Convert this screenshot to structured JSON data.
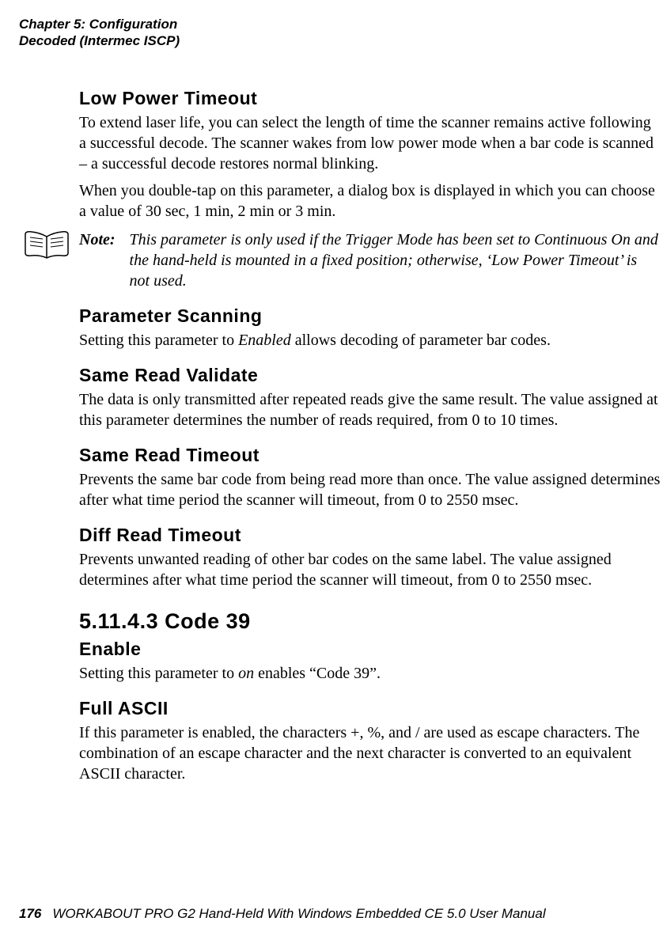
{
  "header": {
    "chapter": "Chapter 5: Configuration",
    "section": "Decoded (Intermec ISCP)"
  },
  "low_power": {
    "title": "Low Power Timeout",
    "p1": "To extend laser life, you can select the length of time the scanner remains active following a successful decode. The scanner wakes from low power mode when a bar code is scanned – a successful decode restores normal blinking.",
    "p2": "When you double-tap on this parameter, a dialog box is displayed in which you can choose a value of 30 sec, 1 min, 2 min or 3 min."
  },
  "note": {
    "label": "Note:",
    "body": "This parameter is only used if the Trigger Mode has been set to Continuous On and the hand-held is mounted in a fixed position; otherwise, ‘Low Power Timeout’ is not used."
  },
  "param_scanning": {
    "title": "Parameter Scanning",
    "p_pre": "Setting this parameter to ",
    "p_em": "Enabled",
    "p_post": " allows decoding of parameter bar codes."
  },
  "same_read_validate": {
    "title": "Same Read Validate",
    "p": "The data is only transmitted after repeated reads give the same result. The value assigned at this parameter determines the number of reads required, from 0 to 10 times."
  },
  "same_read_timeout": {
    "title": "Same Read Timeout",
    "p": "Prevents the same bar code from being read more than once. The value assigned determines after what time period the scanner will timeout, from 0 to 2550 msec."
  },
  "diff_read_timeout": {
    "title": "Diff Read Timeout",
    "p": "Prevents unwanted reading of other bar codes on the same label. The value assigned determines after what time period the scanner will timeout, from 0 to 2550 msec."
  },
  "code39": {
    "number_title": "5.11.4.3   Code 39"
  },
  "enable": {
    "title": "Enable",
    "p_pre": "Setting this parameter to ",
    "p_em": "on",
    "p_post": " enables “Code 39”."
  },
  "full_ascii": {
    "title": "Full ASCII",
    "p": "If this parameter is enabled, the characters +, %, and / are used as escape characters. The combination of an escape character and the next character is converted to an equivalent ASCII character."
  },
  "footer": {
    "page": "176",
    "text": "WORKABOUT PRO G2 Hand-Held With Windows Embedded CE 5.0 User Manual"
  }
}
